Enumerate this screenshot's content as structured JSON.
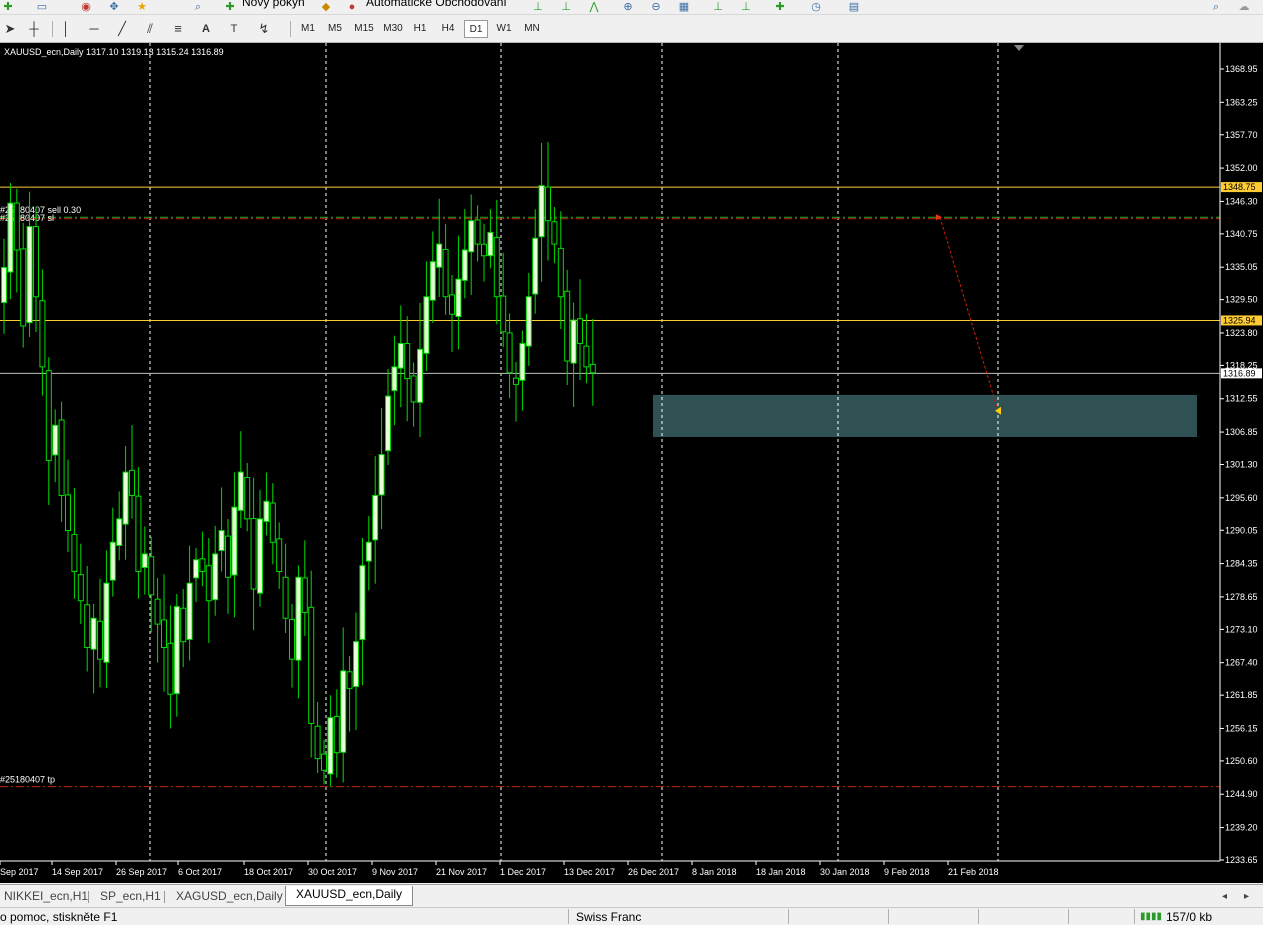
{
  "toolbar": {
    "new_order": "Nový pokyn",
    "auto_trading": "Automatické Obchodování"
  },
  "timeframes": [
    "M1",
    "M5",
    "M15",
    "M30",
    "H1",
    "H4",
    "D1",
    "W1",
    "MN"
  ],
  "active_timeframe": "D1",
  "chart": {
    "header": "XAUUSD_ecn,Daily  1317.10 1319.13 1315.24 1316.89",
    "sell_label": "#25180407 sell 0.30",
    "sl_label": "#25180407 sl",
    "tp_label": "#25180407 tp",
    "price_ticks": [
      "1368.95",
      "1363.25",
      "1357.70",
      "1352.00",
      "1346.30",
      "1340.75",
      "1335.05",
      "1329.50",
      "1323.80",
      "1318.25",
      "1312.55",
      "1306.85",
      "1301.30",
      "1295.60",
      "1290.05",
      "1284.35",
      "1278.65",
      "1273.10",
      "1267.40",
      "1261.85",
      "1256.15",
      "1250.60",
      "1244.90",
      "1239.20",
      "1233.65"
    ],
    "level_labels": [
      "1348.75",
      "1325.94",
      "1316.89"
    ],
    "date_ticks": [
      "Sep 2017",
      "14 Sep 2017",
      "26 Sep 2017",
      "6 Oct 2017",
      "18 Oct 2017",
      "30 Oct 2017",
      "9 Nov 2017",
      "21 Nov 2017",
      "1 Dec 2017",
      "13 Dec 2017",
      "26 Dec 2017",
      "8 Jan 2018",
      "18 Jan 2018",
      "30 Jan 2018",
      "9 Feb 2018",
      "21 Feb 2018"
    ],
    "colors": {
      "background": "#000000",
      "candle": "#00dd00",
      "up_body": "#e8ffd8",
      "level": "#ffcc33",
      "zone": "#2f5153",
      "current": "#c0c0c0",
      "stop": "#cc2200"
    }
  },
  "chart_data": {
    "type": "candlestick",
    "title": "XAUUSD_ecn,Daily",
    "last_bar": {
      "open": 1317.1,
      "high": 1319.13,
      "low": 1315.24,
      "close": 1316.89
    },
    "ylim": [
      1233.65,
      1368.95
    ],
    "horizontal_levels": [
      1348.75,
      1325.94,
      1316.89
    ],
    "stop_levels": {
      "sell_entry": 1343.6,
      "tp": 1246.2
    },
    "support_zone": [
      1306.0,
      1313.2
    ],
    "closes": [
      1335,
      1346,
      1338,
      1325,
      1342,
      1330,
      1318,
      1302,
      1308,
      1296,
      1290,
      1283,
      1278,
      1270,
      1275,
      1268,
      1281,
      1288,
      1292,
      1300,
      1296,
      1283,
      1286,
      1279,
      1274,
      1270,
      1262,
      1277,
      1271,
      1281,
      1285,
      1283,
      1278,
      1286,
      1290,
      1282,
      1294,
      1300,
      1292,
      1280,
      1292,
      1295,
      1288,
      1283,
      1275,
      1268,
      1282,
      1276,
      1257,
      1251,
      1249,
      1258,
      1252,
      1266,
      1263,
      1271,
      1284,
      1288,
      1296,
      1303,
      1313,
      1318,
      1322,
      1316,
      1312,
      1321,
      1330,
      1336,
      1339,
      1330,
      1327,
      1333,
      1338,
      1343,
      1339,
      1337,
      1341,
      1330,
      1324,
      1317,
      1315,
      1322,
      1330,
      1340,
      1349,
      1343,
      1339,
      1330,
      1319,
      1326,
      1322,
      1318,
      1317
    ]
  }
}
